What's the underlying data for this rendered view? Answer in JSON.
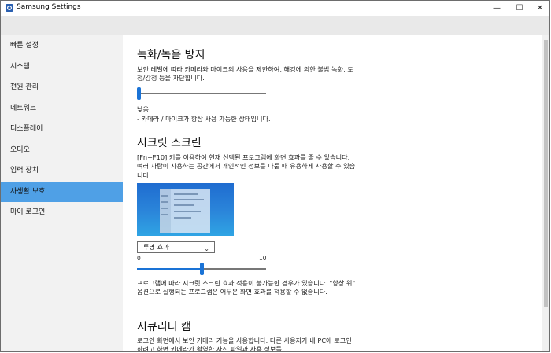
{
  "window": {
    "title": "Samsung Settings",
    "minimize": "—",
    "maximize": "☐",
    "close": "✕"
  },
  "sidebar": {
    "items": [
      {
        "label": "빠른 설정",
        "active": false
      },
      {
        "label": "시스템",
        "active": false
      },
      {
        "label": "전원 관리",
        "active": false
      },
      {
        "label": "네트워크",
        "active": false
      },
      {
        "label": "디스플레이",
        "active": false
      },
      {
        "label": "오디오",
        "active": false
      },
      {
        "label": "입력 장치",
        "active": false
      },
      {
        "label": "사생활 보호",
        "active": true
      },
      {
        "label": "마이 로그인",
        "active": false
      }
    ]
  },
  "recording": {
    "title": "녹화/녹음 방지",
    "description": "보안 레벨에 따라 카메라와 마이크의 사용을 제한하여, 해킹에 의한 불법 녹화, 도청/감청 등을 차단합니다.",
    "level_fraction": 0,
    "level_label": "낮음",
    "level_detail": "- 카메라 / 마이크가 항상 사용 가능한 상태입니다."
  },
  "secret_screen": {
    "title": "시크릿 스크린",
    "description": "[Fn+F10] 키를 이용하여 현재 선택된 프로그램에 화면 효과를 줄 수 있습니다. 여러 사람이 사용하는 공간에서 개인적인 정보를 다룰 때 유용하게 사용할 수 있습니다.",
    "effect_selected": "투명 효과",
    "slider_min": "0",
    "slider_max": "10",
    "slider_value": 5,
    "note": "프로그램에 따라 시크릿 스크린 효과 적용이 불가능한 경우가 있습니다. \"항상 위\" 옵션으로 실행되는 프로그램은 어두운 화면 효과를 적용할 수 없습니다."
  },
  "security_cam": {
    "title": "시큐리티 캠",
    "description": "로그인 화면에서 보안 카메라 기능을 사용합니다. 다른 사용자가 내 PC에 로그인하려고 하면 카메라가 촬영한 사진 파일과 사용 정보를"
  },
  "icons": {
    "app": "samsung-settings-icon",
    "dropdown": "chevron-down-icon"
  },
  "colors": {
    "accent": "#1a73d6",
    "active_nav": "#4fa0e6"
  }
}
